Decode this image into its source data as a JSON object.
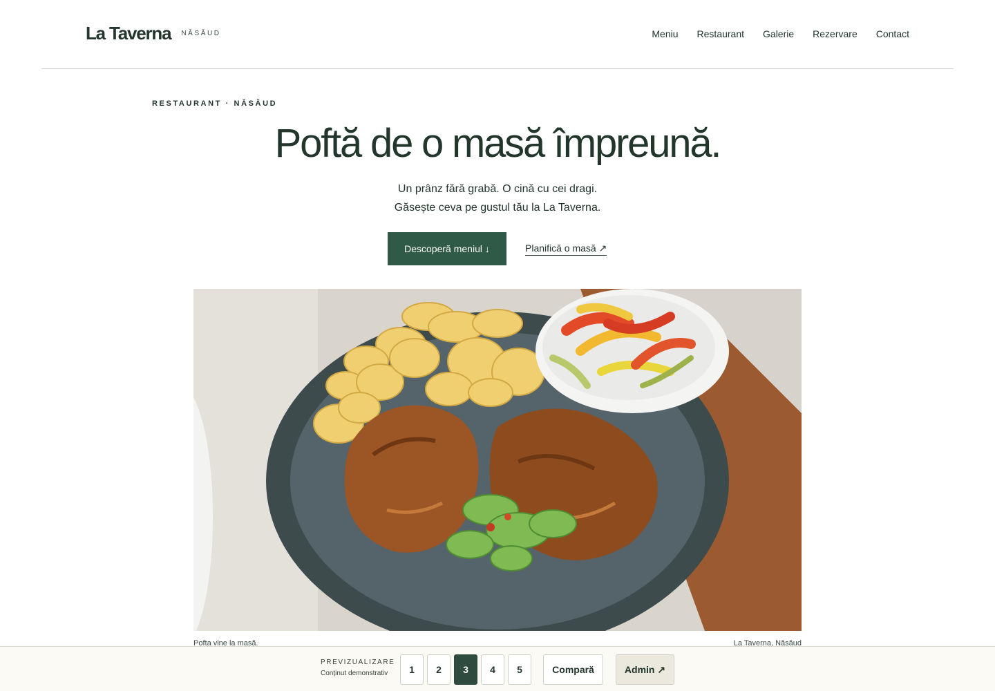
{
  "header": {
    "brand_name": "La Taverna",
    "brand_location": "NĂSĂUD",
    "nav": [
      "Meniu",
      "Restaurant",
      "Galerie",
      "Rezervare",
      "Contact"
    ]
  },
  "hero": {
    "eyebrow": "RESTAURANT · NĂSĂUD",
    "title": "Poftă de o masă împreună.",
    "subtitle_line1": "Un prânz fără grabă. O cină cu cei dragi.",
    "subtitle_line2": "Găsește ceva pe gustul tău la La Taverna.",
    "primary_cta": "Descoperă meniul ↓",
    "secondary_cta": "Planifică o masă ↗"
  },
  "photo": {
    "caption_left": "Pofta vine la masă.",
    "caption_right": "La Taverna, Năsăud"
  },
  "preview_bar": {
    "title": "PREVIZUALIZARE",
    "subtitle": "Conținut demonstrativ",
    "pages": [
      "1",
      "2",
      "3",
      "4",
      "5"
    ],
    "active_page": "3",
    "compare_label": "Compară",
    "admin_label": "Admin ↗"
  },
  "colors": {
    "primary": "#2f5a47",
    "text": "#22342b",
    "active_page": "#2f4a3e",
    "bar_bg": "#fbfaf4"
  }
}
